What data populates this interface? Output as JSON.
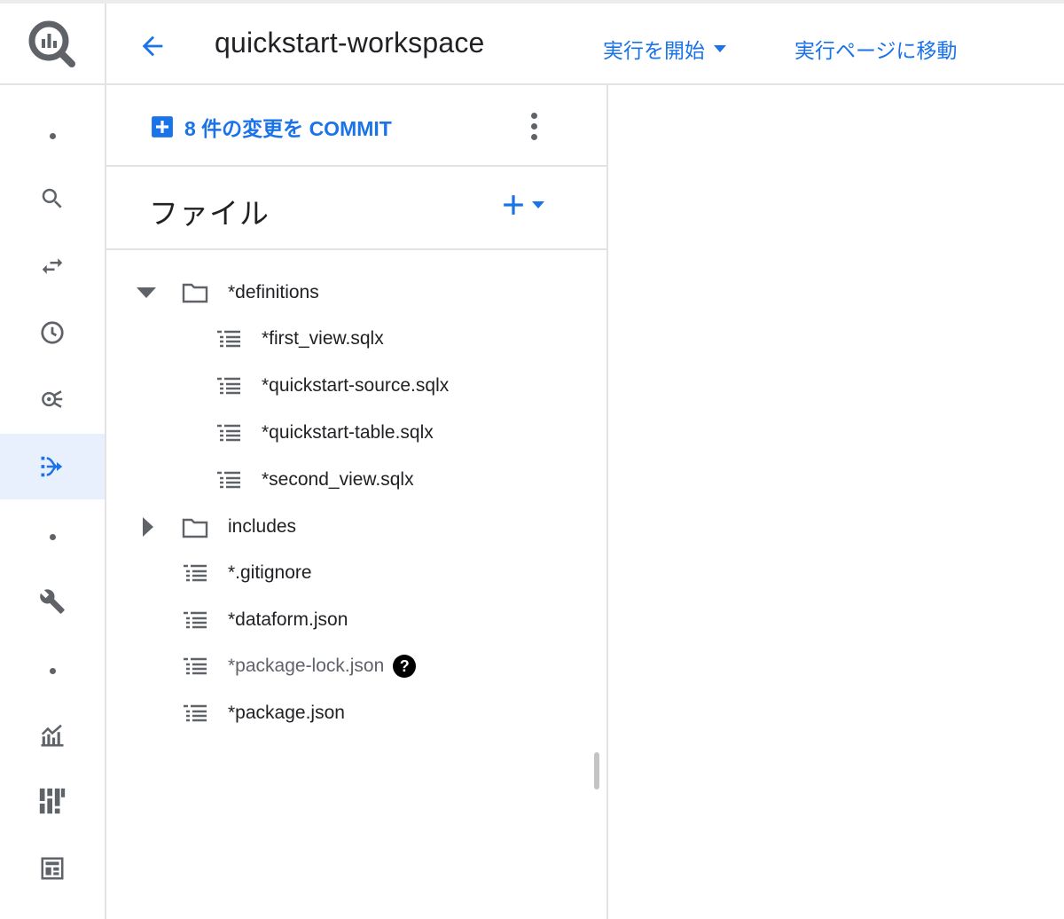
{
  "header": {
    "workspace_title": "quickstart-workspace",
    "run_start_label": "実行を開始",
    "goto_run_label": "実行ページに移動"
  },
  "sidebar": {
    "items": [
      {
        "icon": "dot-icon"
      },
      {
        "icon": "search-icon"
      },
      {
        "icon": "transfer-icon"
      },
      {
        "icon": "history-clock-icon"
      },
      {
        "icon": "analytics-hub-icon"
      },
      {
        "icon": "dataform-pipeline-icon",
        "active": true
      },
      {
        "icon": "dot-icon"
      },
      {
        "icon": "wrench-icon"
      },
      {
        "icon": "dot-icon"
      },
      {
        "icon": "monitoring-chart-icon"
      },
      {
        "icon": "bi-engine-icon"
      },
      {
        "icon": "dashboard-icon"
      }
    ]
  },
  "panel": {
    "commit_label": "8 件の変更を COMMIT",
    "files_title": "ファイル"
  },
  "tree": {
    "definitions": {
      "label": "*definitions",
      "expanded": true
    },
    "def_files": [
      "*first_view.sqlx",
      "*quickstart-source.sqlx",
      "*quickstart-table.sqlx",
      "*second_view.sqlx"
    ],
    "includes": {
      "label": "includes",
      "expanded": false
    },
    "root_files": [
      "*.gitignore",
      "*dataform.json",
      "*package-lock.json",
      "*package.json"
    ]
  },
  "colors": {
    "accent": "#1a73e8",
    "border": "#e3e3e3",
    "active_bg": "#e8f0fe",
    "icon_gray": "#5f6368"
  }
}
